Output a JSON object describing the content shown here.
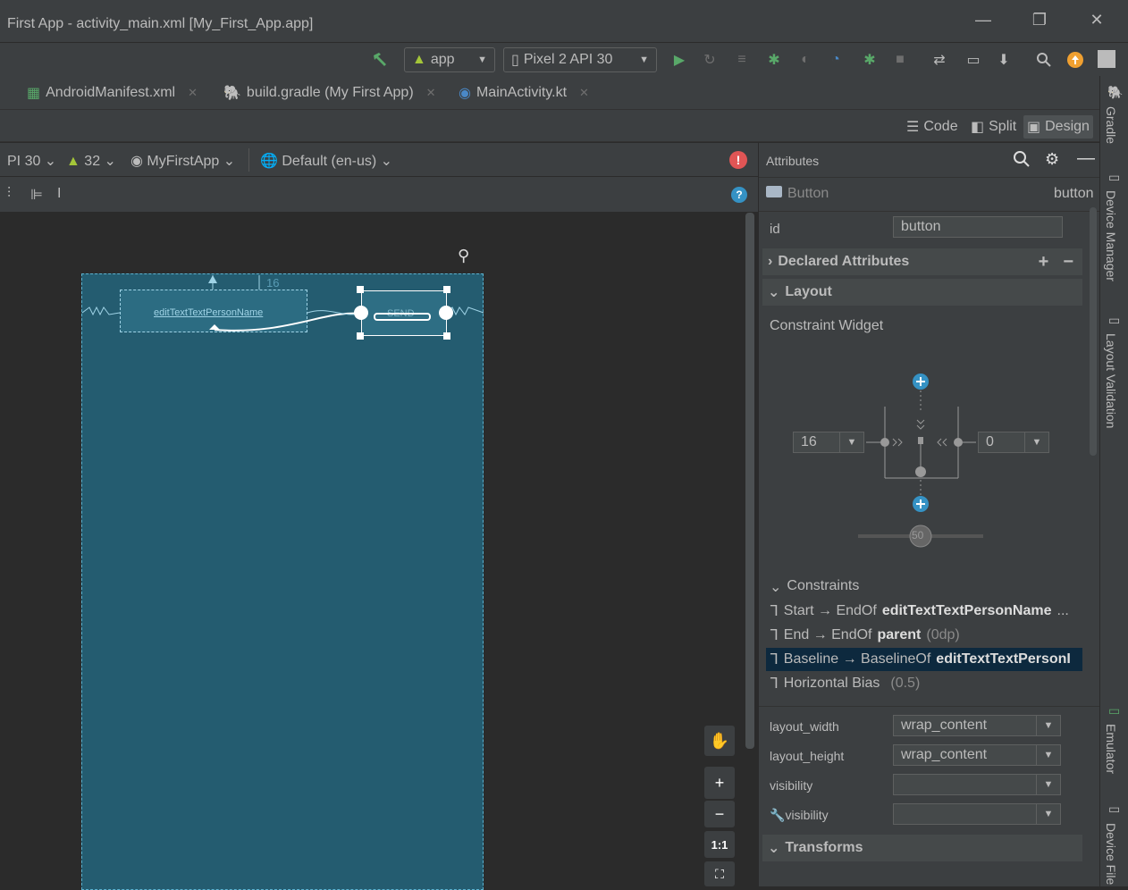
{
  "window": {
    "title": "First App - activity_main.xml [My_First_App.app]"
  },
  "toolbar": {
    "run_config": "app",
    "device": "Pixel 2 API 30"
  },
  "tabs": [
    {
      "label": "AndroidManifest.xml"
    },
    {
      "label": "build.gradle (My First App)"
    },
    {
      "label": "MainActivity.kt"
    }
  ],
  "modes": {
    "code": "Code",
    "split": "Split",
    "design": "Design"
  },
  "canvas_bar": {
    "api": "PI 30",
    "api_level": "32",
    "theme": "MyFirstApp",
    "locale": "Default (en-us)"
  },
  "layout_preview": {
    "edit_text_label": "editTextTextPersonName",
    "button_label": "SEND",
    "margin_value": "16"
  },
  "zoom": {
    "fit": "1:1"
  },
  "attributes": {
    "panel_title": "Attributes",
    "component_type": "Button",
    "component_id": "button",
    "id_label": "id",
    "id_value": "button",
    "declared_attributes": "Declared Attributes",
    "layout_section": "Layout",
    "constraint_widget": "Constraint Widget",
    "margin_start": "16",
    "margin_end": "0",
    "bias": "50",
    "constraints_title": "Constraints",
    "constraints": [
      {
        "prefix": "Start → EndOf",
        "target": "editTextTextPersonName",
        "suffix": "..."
      },
      {
        "prefix": "End → EndOf",
        "target": "parent",
        "suffix": "(0dp)"
      },
      {
        "prefix": "Baseline → BaselineOf",
        "target": "editTextTextPersonI",
        "suffix": ""
      },
      {
        "prefix": "Horizontal Bias",
        "target": "",
        "suffix": "(0.5)"
      }
    ],
    "props": [
      {
        "label": "layout_width",
        "value": "wrap_content"
      },
      {
        "label": "layout_height",
        "value": "wrap_content"
      },
      {
        "label": "visibility",
        "value": ""
      },
      {
        "label": "visibility",
        "value": ""
      }
    ],
    "transforms": "Transforms"
  },
  "side_tools": [
    "Gradle",
    "Device Manager",
    "Layout Validation",
    "Emulator",
    "Device File"
  ],
  "colors": {
    "accent": "#4a88c7",
    "error": "#e05555",
    "run": "#59a869",
    "canvas": "#245c70"
  }
}
